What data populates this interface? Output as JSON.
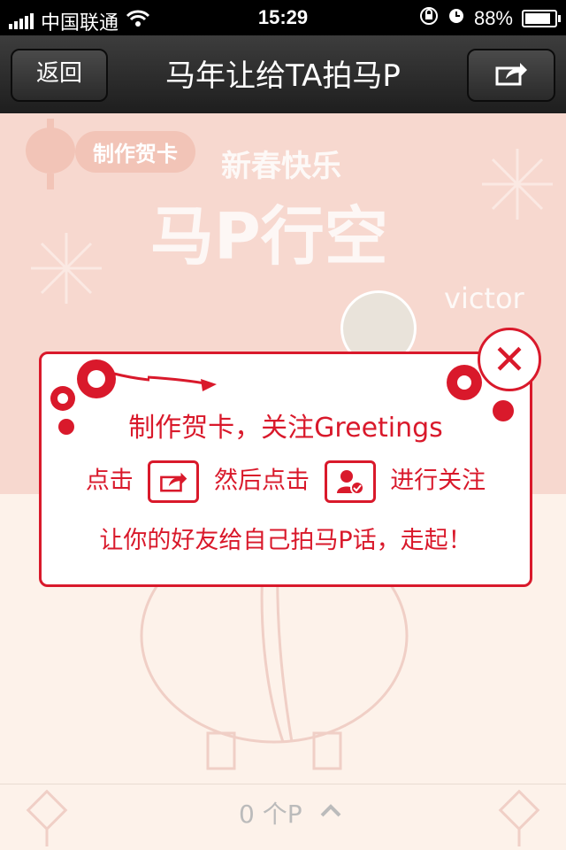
{
  "status_bar": {
    "carrier": "中国联通",
    "time": "15:29",
    "battery": "88%",
    "battery_level": 0.88
  },
  "nav": {
    "back_label": "返回",
    "title": "马年让给TA拍马P"
  },
  "background": {
    "badge": "制作贺卡",
    "greeting": "新春快乐",
    "title": "马P行空",
    "username": "victor"
  },
  "modal": {
    "line1": "制作贺卡，关注Greetings",
    "line2_part1": "点击",
    "line2_part2": "然后点击",
    "line2_part3": "进行关注",
    "line3": "让你的好友给自己拍马P话，走起！"
  },
  "bottom": {
    "count_label": "0 个P"
  },
  "colors": {
    "accent": "#d9192b",
    "bg_pink": "#f7d8cf",
    "bg_cream": "#fdf2ea",
    "nav_dark": "#2a2a2a"
  }
}
